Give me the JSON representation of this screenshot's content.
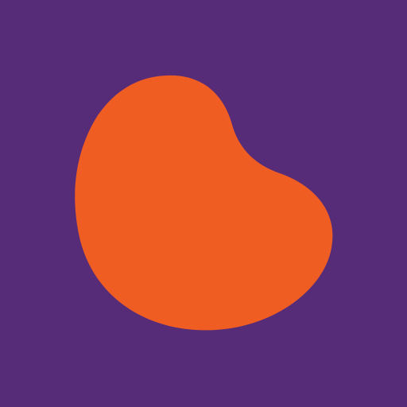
{
  "icon": {
    "name": "bean-icon",
    "background_color": "#562c78",
    "shape_color": "#f05d23"
  }
}
